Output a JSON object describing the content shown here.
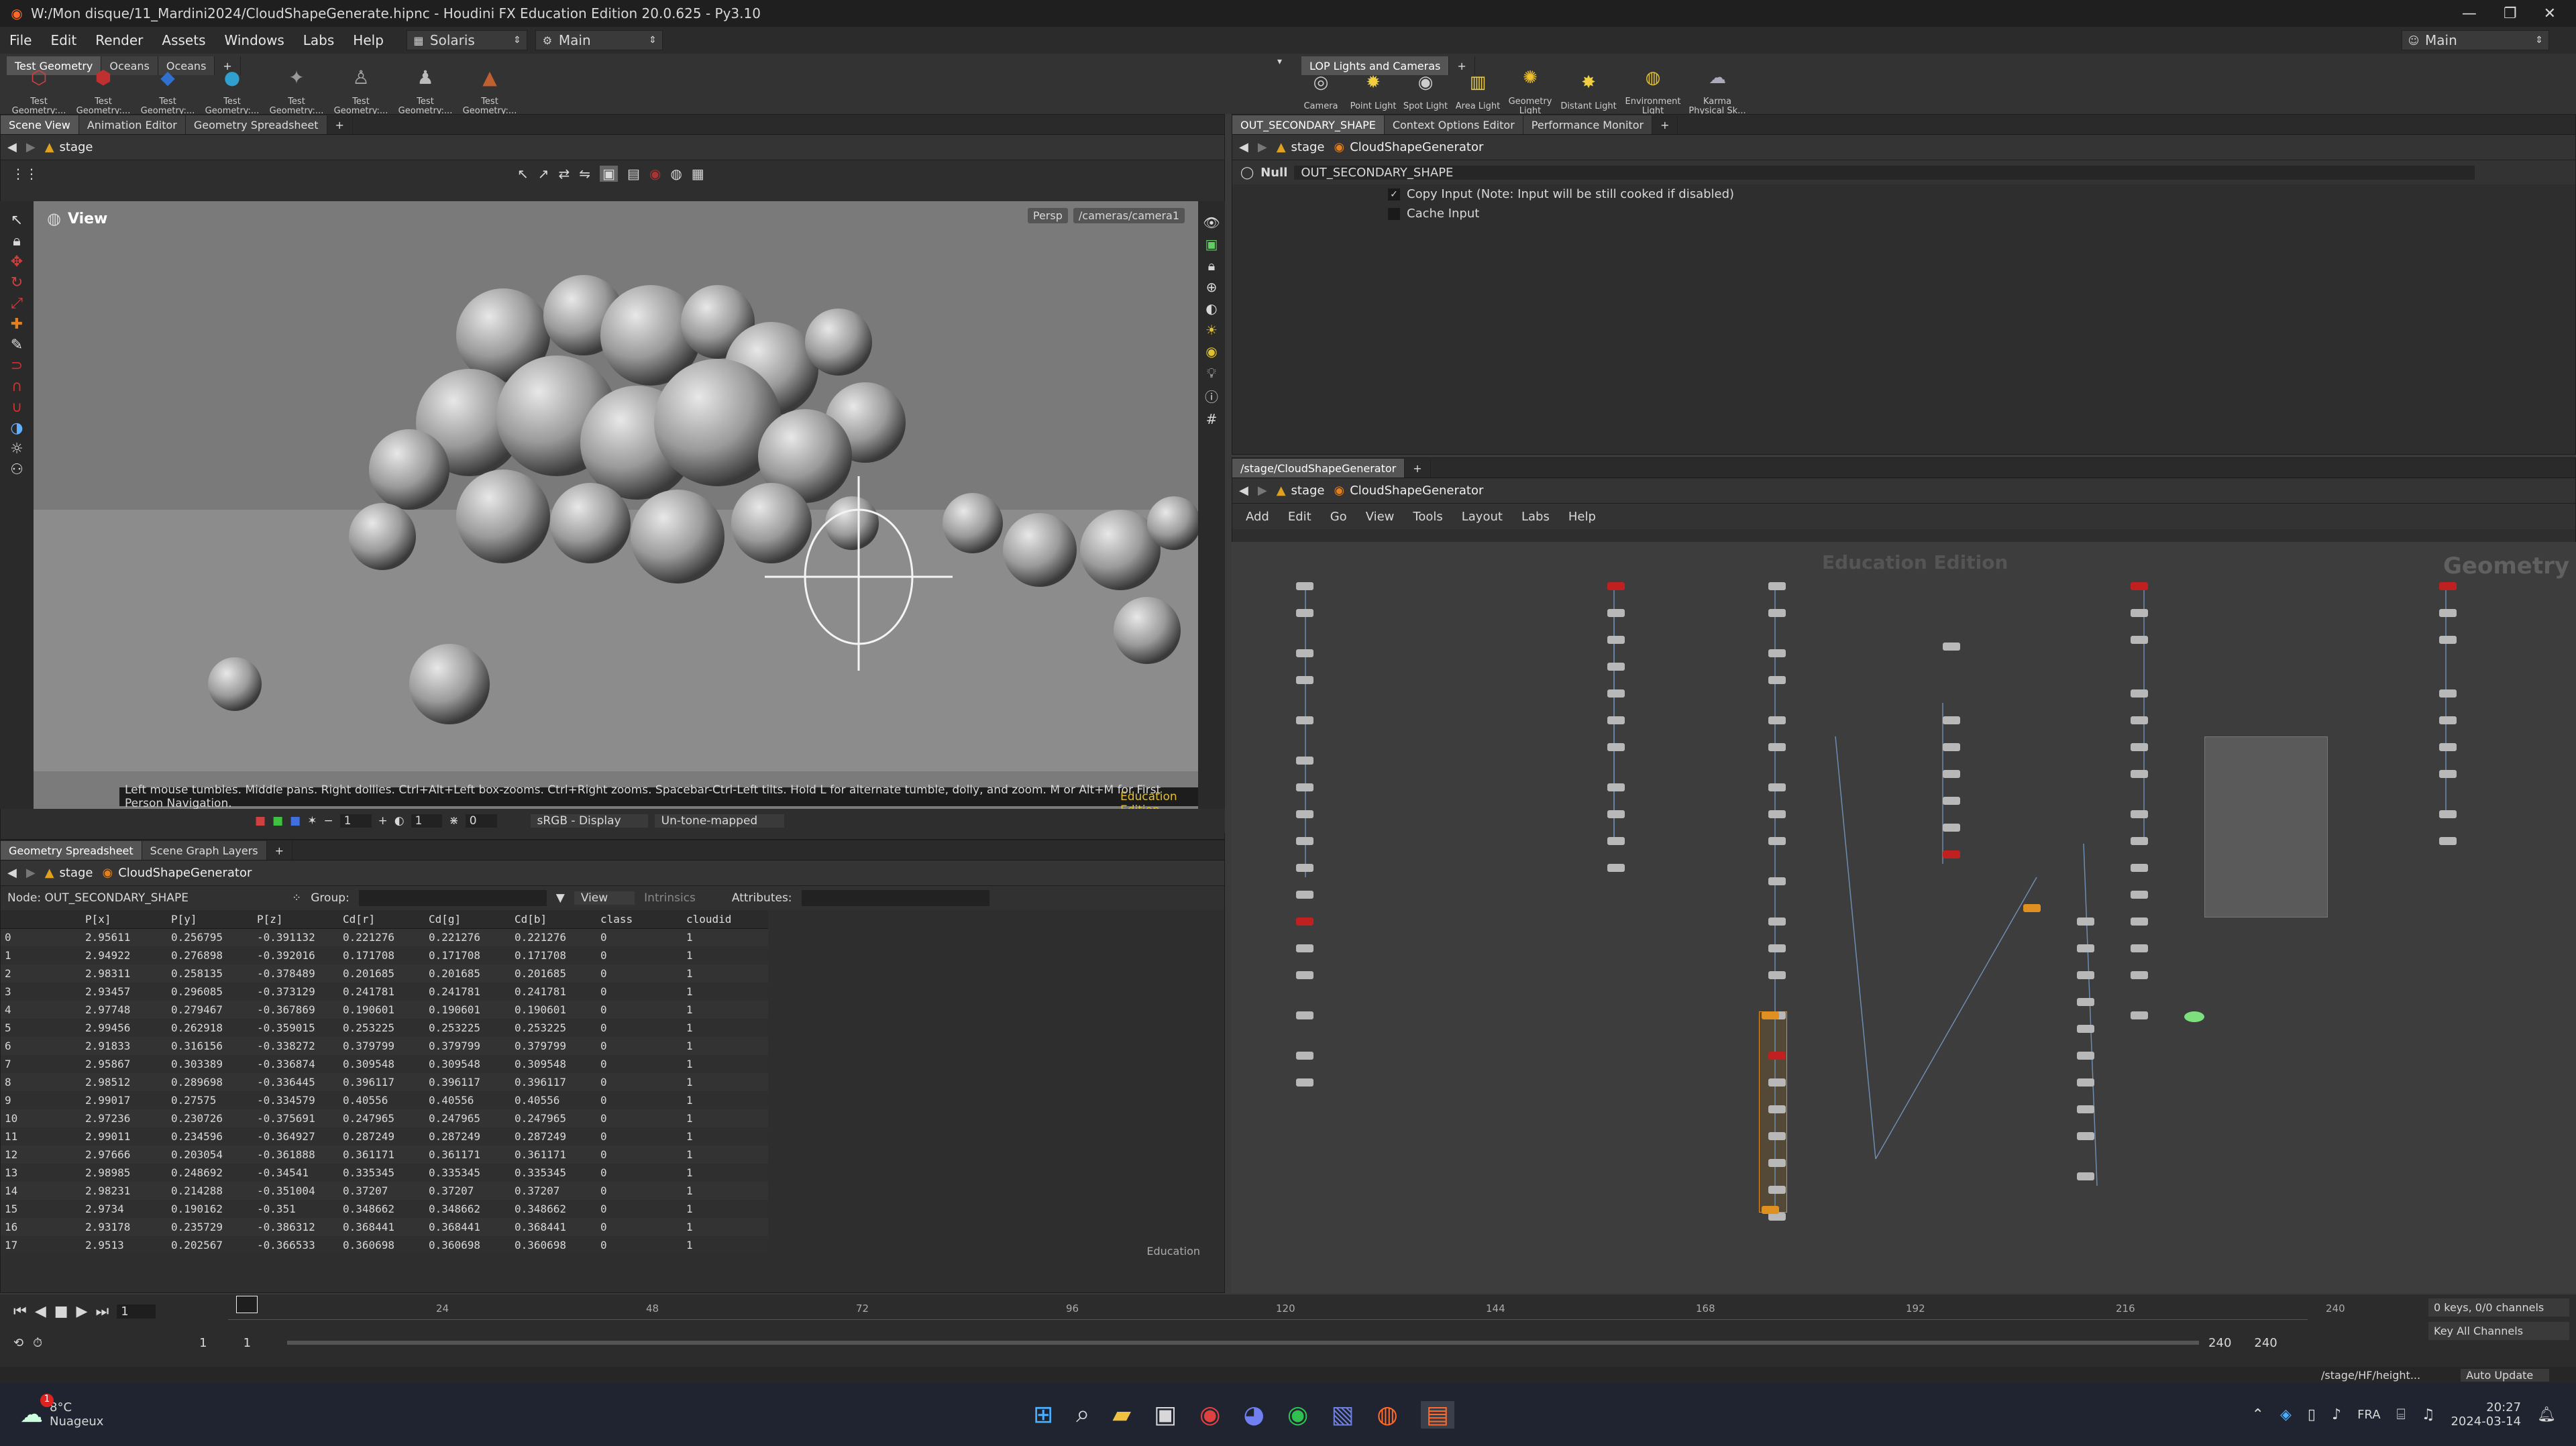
{
  "window": {
    "title": "W:/Mon disque/11_Mardini2024/CloudShapeGenerate.hipnc - Houdini FX Education Edition 20.0.625 - Py3.10"
  },
  "menu": {
    "items": [
      "File",
      "Edit",
      "Render",
      "Assets",
      "Windows",
      "Labs",
      "Help"
    ],
    "desktop": "Solaris",
    "context": "Main",
    "right_context": "Main"
  },
  "shelf_left": {
    "tabs": [
      "Test Geometry",
      "Oceans",
      "Oceans"
    ],
    "tools": [
      "Test Geometry:...",
      "Test Geometry:...",
      "Test Geometry:...",
      "Test Geometry:...",
      "Test Geometry:...",
      "Test Geometry:...",
      "Test Geometry:...",
      "Test Geometry:..."
    ]
  },
  "shelf_right": {
    "tabs": [
      "LOP Lights and Cameras"
    ],
    "tools": [
      "Camera",
      "Point Light",
      "Spot Light",
      "Area Light",
      "Geometry Light",
      "Distant Light",
      "Environment Light",
      "Karma Physical Sk..."
    ]
  },
  "left_pane": {
    "tabs": [
      "Scene View",
      "Animation Editor",
      "Geometry Spreadsheet"
    ],
    "path": "stage",
    "viewport_label": "View",
    "persp": "Persp",
    "camera": "/cameras/camera1",
    "hint": "Left mouse tumbles. Middle pans. Right dollies. Ctrl+Alt+Left box-zooms. Ctrl+Right zooms. Spacebar-Ctrl-Left tilts. Hold L for alternate tumble, dolly, and zoom. M or Alt+M for First Person Navigation.",
    "edition_badge": "Education Edition",
    "display_color": "sRGB - Display",
    "tonemap": "Un-tone-mapped",
    "field_a": "1",
    "field_b": "1",
    "field_c": "0"
  },
  "params_pane": {
    "tabs": [
      "OUT_SECONDARY_SHAPE",
      "Context Options Editor",
      "Performance Monitor"
    ],
    "path_stage": "stage",
    "path_node": "CloudShapeGenerator",
    "node_type": "Null",
    "node_name": "OUT_SECONDARY_SHAPE",
    "copy_input": "Copy Input (Note: Input will be still cooked if disabled)",
    "cache_input": "Cache Input"
  },
  "network_pane": {
    "tab": "/stage/CloudShapeGenerator",
    "path_stage": "stage",
    "path_node": "CloudShapeGenerator",
    "menu": [
      "Add",
      "Edit",
      "Go",
      "View",
      "Tools",
      "Layout",
      "Labs",
      "Help"
    ],
    "watermark": "Education Edition",
    "context_label": "Geometry"
  },
  "spreadsheet": {
    "tabs": [
      "Geometry Spreadsheet",
      "Scene Graph Layers"
    ],
    "path_stage": "stage",
    "path_node": "CloudShapeGenerator",
    "node_label": "Node: OUT_SECONDARY_SHAPE",
    "group_label": "Group:",
    "view_label": "View",
    "intrinsics_label": "Intrinsics",
    "attributes_label": "Attributes:",
    "columns": [
      "",
      "P[x]",
      "P[y]",
      "P[z]",
      "Cd[r]",
      "Cd[g]",
      "Cd[b]",
      "class",
      "cloudid"
    ],
    "rows": [
      [
        "0",
        "2.95611",
        "0.256795",
        "-0.391132",
        "0.221276",
        "0.221276",
        "0.221276",
        "0",
        "1"
      ],
      [
        "1",
        "2.94922",
        "0.276898",
        "-0.392016",
        "0.171708",
        "0.171708",
        "0.171708",
        "0",
        "1"
      ],
      [
        "2",
        "2.98311",
        "0.258135",
        "-0.378489",
        "0.201685",
        "0.201685",
        "0.201685",
        "0",
        "1"
      ],
      [
        "3",
        "2.93457",
        "0.296085",
        "-0.373129",
        "0.241781",
        "0.241781",
        "0.241781",
        "0",
        "1"
      ],
      [
        "4",
        "2.97748",
        "0.279467",
        "-0.367869",
        "0.190601",
        "0.190601",
        "0.190601",
        "0",
        "1"
      ],
      [
        "5",
        "2.99456",
        "0.262918",
        "-0.359015",
        "0.253225",
        "0.253225",
        "0.253225",
        "0",
        "1"
      ],
      [
        "6",
        "2.91833",
        "0.316156",
        "-0.338272",
        "0.379799",
        "0.379799",
        "0.379799",
        "0",
        "1"
      ],
      [
        "7",
        "2.95867",
        "0.303389",
        "-0.336874",
        "0.309548",
        "0.309548",
        "0.309548",
        "0",
        "1"
      ],
      [
        "8",
        "2.98512",
        "0.289698",
        "-0.336445",
        "0.396117",
        "0.396117",
        "0.396117",
        "0",
        "1"
      ],
      [
        "9",
        "2.99017",
        "0.27575",
        "-0.334579",
        "0.40556",
        "0.40556",
        "0.40556",
        "0",
        "1"
      ],
      [
        "10",
        "2.97236",
        "0.230726",
        "-0.375691",
        "0.247965",
        "0.247965",
        "0.247965",
        "0",
        "1"
      ],
      [
        "11",
        "2.99011",
        "0.234596",
        "-0.364927",
        "0.287249",
        "0.287249",
        "0.287249",
        "0",
        "1"
      ],
      [
        "12",
        "2.97666",
        "0.203054",
        "-0.361888",
        "0.361171",
        "0.361171",
        "0.361171",
        "0",
        "1"
      ],
      [
        "13",
        "2.98985",
        "0.248692",
        "-0.34541",
        "0.335345",
        "0.335345",
        "0.335345",
        "0",
        "1"
      ],
      [
        "14",
        "2.98231",
        "0.214288",
        "-0.351004",
        "0.37207",
        "0.37207",
        "0.37207",
        "0",
        "1"
      ],
      [
        "15",
        "2.9734",
        "0.190162",
        "-0.351",
        "0.348662",
        "0.348662",
        "0.348662",
        "0",
        "1"
      ],
      [
        "16",
        "2.93178",
        "0.235729",
        "-0.386312",
        "0.368441",
        "0.368441",
        "0.368441",
        "0",
        "1"
      ],
      [
        "17",
        "2.9513",
        "0.202567",
        "-0.366533",
        "0.360698",
        "0.360698",
        "0.360698",
        "0",
        "1"
      ]
    ],
    "footer": "Education"
  },
  "timeline": {
    "frame_current": "1",
    "ticks": [
      "24",
      "48",
      "72",
      "96",
      "120",
      "144",
      "168",
      "192",
      "216",
      "240"
    ],
    "range_start": "1",
    "range_start2": "1",
    "range_end": "240",
    "range_end2": "240",
    "keys": "0 keys, 0/0 channels",
    "key_all": "Key All Channels",
    "status_path": "/stage/HF/height...",
    "auto_update": "Auto Update"
  },
  "taskbar": {
    "temperature": "8°C",
    "weather": "Nuageux",
    "language": "FRA",
    "time": "20:27",
    "date": "2024-03-14",
    "badge": "1"
  }
}
